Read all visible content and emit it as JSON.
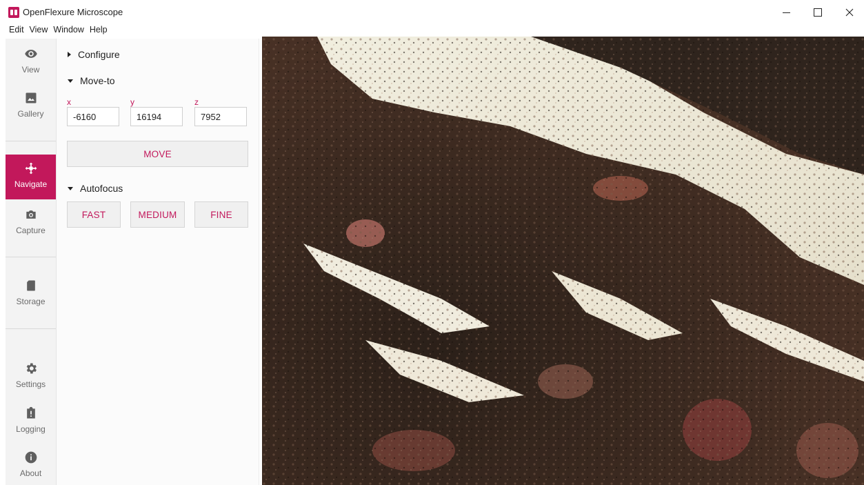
{
  "window": {
    "title": "OpenFlexure Microscope",
    "minimize": "—",
    "maximize": "☐",
    "close": "✕"
  },
  "menu": [
    "Edit",
    "View",
    "Window",
    "Help"
  ],
  "nav": {
    "view": "View",
    "gallery": "Gallery",
    "navigate": "Navigate",
    "capture": "Capture",
    "storage": "Storage",
    "settings": "Settings",
    "logging": "Logging",
    "about": "About",
    "active": "navigate"
  },
  "panel": {
    "configure": {
      "title": "Configure",
      "expanded": false
    },
    "move_to": {
      "title": "Move-to",
      "expanded": true,
      "x_label": "x",
      "y_label": "y",
      "z_label": "z",
      "x_value": "-6160",
      "y_value": "16194",
      "z_value": "7952",
      "move_button": "MOVE"
    },
    "autofocus": {
      "title": "Autofocus",
      "expanded": true,
      "fast": "FAST",
      "medium": "MEDIUM",
      "fine": "FINE"
    }
  },
  "colors": {
    "accent": "#c2185b",
    "rail_bg": "#f3f3f3",
    "panel_bg": "#fbfbfb",
    "button_bg": "#f0f0f0"
  },
  "viewer": {
    "content": "live microscope camera image of stained tissue sample"
  }
}
